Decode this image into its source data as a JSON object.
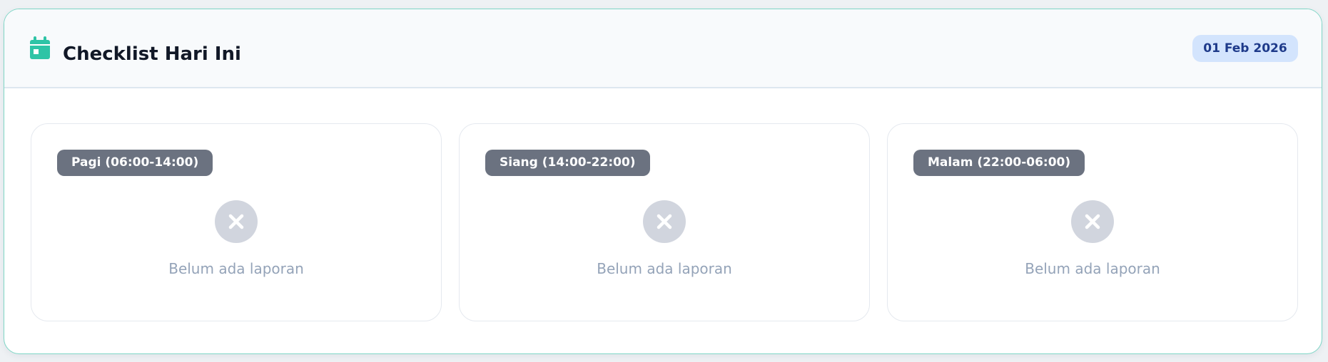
{
  "header": {
    "icon": "calendar-icon",
    "title": "Checklist Hari Ini",
    "date": "01 Feb 2026",
    "accent_color": "#2ec4a6"
  },
  "shifts": [
    {
      "label": "Pagi (06:00-14:00)",
      "status_icon": "close-icon",
      "status_text": "Belum ada laporan"
    },
    {
      "label": "Siang (14:00-22:00)",
      "status_icon": "close-icon",
      "status_text": "Belum ada laporan"
    },
    {
      "label": "Malam (22:00-06:00)",
      "status_icon": "close-icon",
      "status_text": "Belum ada laporan"
    }
  ]
}
